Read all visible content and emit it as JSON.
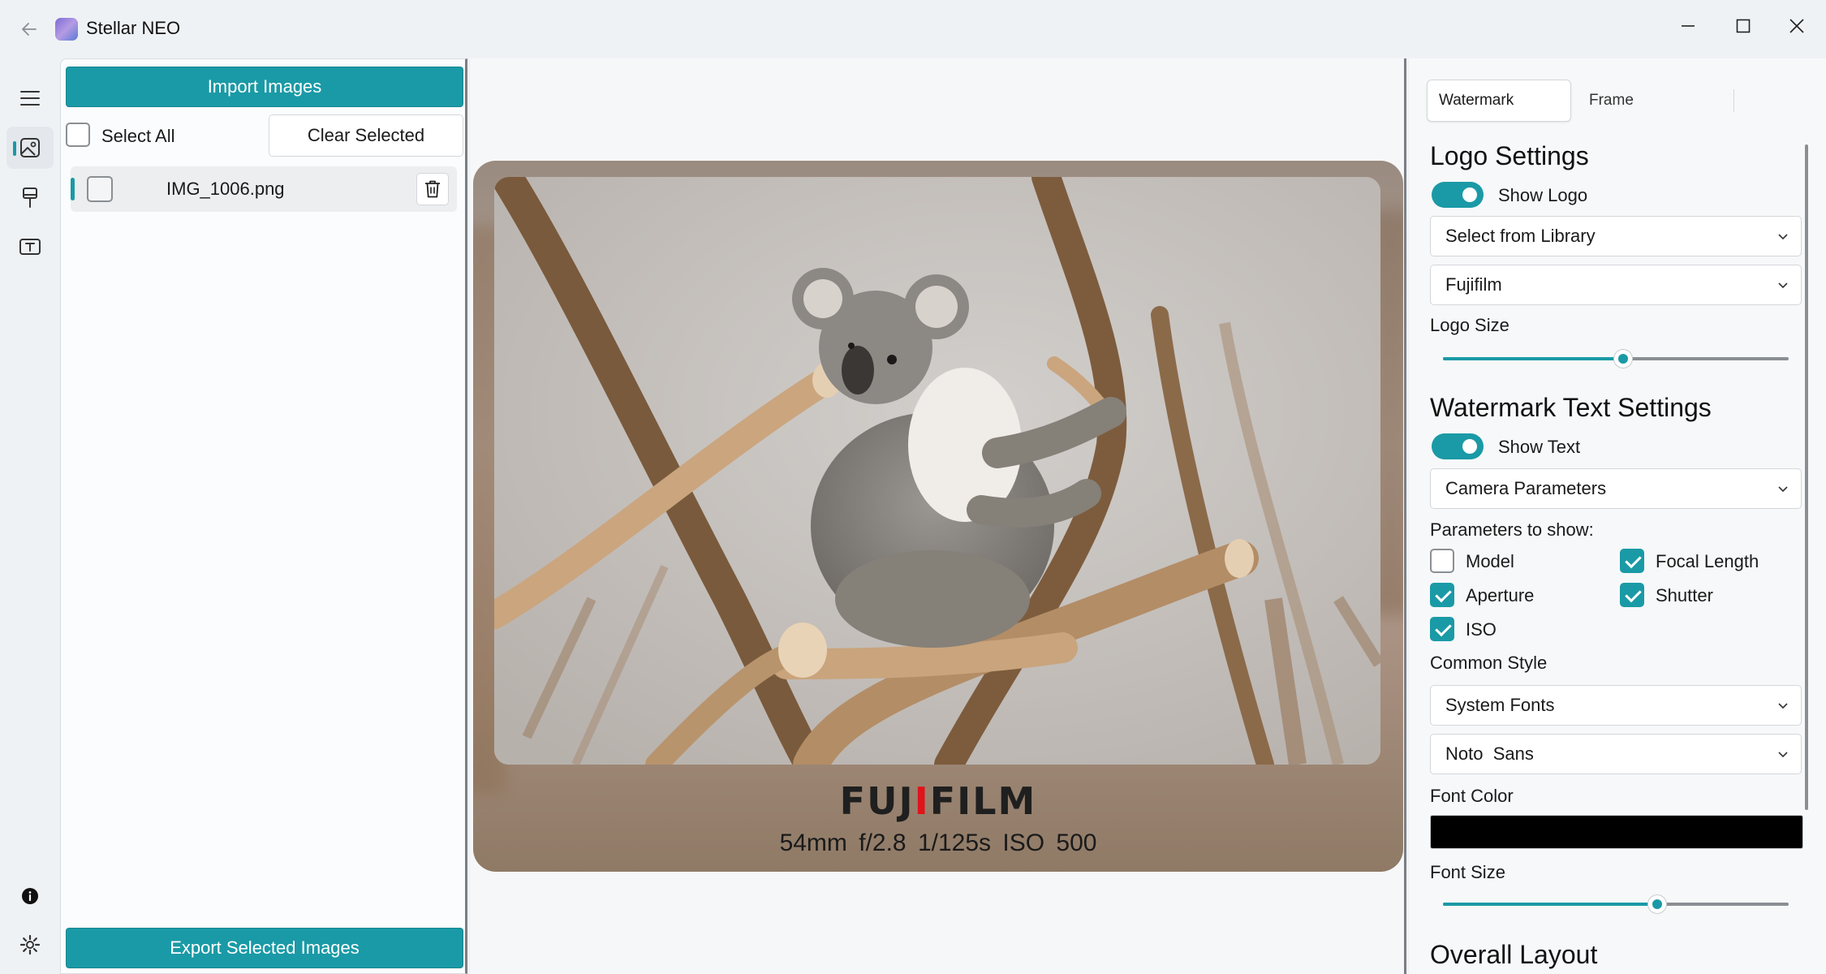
{
  "window": {
    "title": "Stellar NEO"
  },
  "nav": {
    "items": [
      {
        "icon": "menu-icon"
      },
      {
        "icon": "image-icon",
        "active": true
      },
      {
        "icon": "brush-icon"
      },
      {
        "icon": "text-icon"
      },
      {
        "icon": "info-icon"
      },
      {
        "icon": "gear-icon"
      }
    ]
  },
  "image_list": {
    "import_label": "Import Images",
    "select_all_label": "Select All",
    "select_all_checked": false,
    "clear_label": "Clear Selected",
    "files": [
      {
        "name": "IMG_1006.png",
        "checked": false,
        "selected": true
      }
    ],
    "export_label": "Export Selected Images"
  },
  "preview": {
    "logo_brand": "FUJIFILM",
    "logo_parts": [
      "FUJ",
      "I",
      "FILM"
    ],
    "params_text": "54mm  f/2.8  1/125s  ISO 500"
  },
  "settings": {
    "tabs": [
      {
        "label": "Watermark",
        "active": true
      },
      {
        "label": "Frame",
        "active": false
      }
    ],
    "logo": {
      "title": "Logo Settings",
      "show_logo_label": "Show Logo",
      "show_logo_on": true,
      "source": "Select from Library",
      "brand": "Fujifilm",
      "size_label": "Logo Size",
      "size_value": 0.52
    },
    "text": {
      "title": "Watermark Text Settings",
      "show_text_label": "Show Text",
      "show_text_on": true,
      "source": "Camera Parameters",
      "params_label": "Parameters to show:",
      "params": [
        {
          "label": "Model",
          "checked": false
        },
        {
          "label": "Focal Length",
          "checked": true
        },
        {
          "label": "Aperture",
          "checked": true
        },
        {
          "label": "Shutter",
          "checked": true
        },
        {
          "label": "ISO",
          "checked": true
        }
      ],
      "style_label": "Common Style",
      "font_source": "System Fonts",
      "font_family": "Noto  Sans",
      "color_label": "Font Color",
      "color_value": "#000000",
      "size_label": "Font Size",
      "size_value": 0.62
    },
    "layout": {
      "title": "Overall Layout"
    }
  },
  "colors": {
    "accent": "#1a9aa6",
    "background": "#eff2f5",
    "fuji_red": "#e0141a"
  }
}
